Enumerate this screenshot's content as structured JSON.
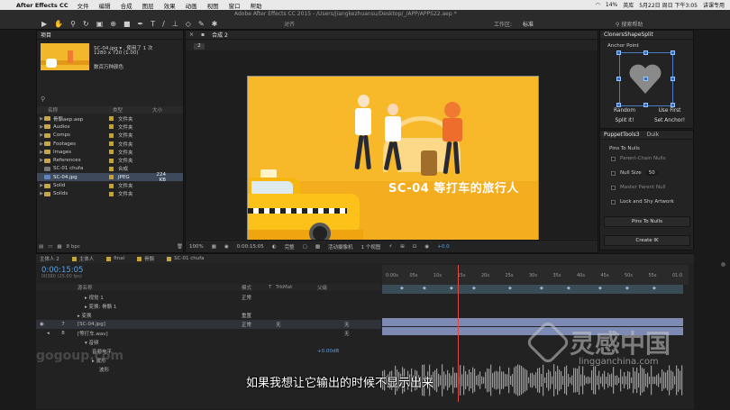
{
  "menubar": {
    "app": "After Effects CC",
    "items": [
      "文件",
      "编辑",
      "合成",
      "图层",
      "效果",
      "动画",
      "视图",
      "窗口",
      "帮助"
    ],
    "status": [
      "14%",
      "英库",
      "5月22日 周日 下午3:05",
      "讲课专用"
    ]
  },
  "window_title": "Adobe After Effects CC 2015 - /Users/jiangkezhuansu/Desktop/_/APP/APPS22.aep *",
  "toolbar": {
    "align": "对齐",
    "workspace_label": "工作区:",
    "workspace_value": "标准",
    "search": "搜索帮助"
  },
  "project": {
    "tab": "项目",
    "selected_name": "SC-04.jpg ▾ , 使用了 1 次",
    "selected_dims": "1280 x 720 (1.00)",
    "selected_colors": "数百万种颜色",
    "columns": [
      "名称",
      "类型",
      "大小"
    ],
    "items": [
      {
        "name": "骨骼aep.aep",
        "type": "文件夹",
        "size": "",
        "kind": "folder"
      },
      {
        "name": "Audios",
        "type": "文件夹",
        "size": "",
        "kind": "folder"
      },
      {
        "name": "Comps",
        "type": "文件夹",
        "size": "",
        "kind": "folder"
      },
      {
        "name": "Footages",
        "type": "文件夹",
        "size": "",
        "kind": "folder"
      },
      {
        "name": "Images",
        "type": "文件夹",
        "size": "",
        "kind": "folder"
      },
      {
        "name": "References",
        "type": "文件夹",
        "size": "",
        "kind": "folder"
      },
      {
        "name": "SC-01 chufa",
        "type": "合成",
        "size": "",
        "kind": "comp"
      },
      {
        "name": "SC-04.jpg",
        "type": "JPEG",
        "size": "224 KB",
        "kind": "img"
      },
      {
        "name": "Solid",
        "type": "文件夹",
        "size": "",
        "kind": "folder"
      },
      {
        "name": "Solids",
        "type": "文件夹",
        "size": "",
        "kind": "folder"
      }
    ],
    "bpc": "8 bpc"
  },
  "composition": {
    "tab_label": "合成 2",
    "comp_number": "2",
    "caption": "SC-04 等打车的旅行人",
    "footer": {
      "zoom": "100%",
      "timecode": "0:00:15:05",
      "quality": "完整",
      "camera": "活动摄像机",
      "views": "1 个视图",
      "exposure": "+0.0"
    }
  },
  "clone": {
    "title": "ClonersShapeSplit",
    "anchor": "Anchor Point",
    "buttons": [
      "Random",
      "Use First",
      "Split it!",
      "Set Anchor!"
    ]
  },
  "puppet": {
    "tabs": [
      "PuppetTools3",
      "Duik"
    ],
    "pins_to_nulls_header": "Pins To Nulls",
    "parent_chain": "Parent-Chain Nulls",
    "null_size_label": "Null Size",
    "null_size_value": "50",
    "master_parent": "Master Parent Null",
    "lock_shy": "Lock and Shy Artwork",
    "pins_button": "Pins To Nulls",
    "create_ik": "Create IK"
  },
  "timeline": {
    "tabs": [
      "主体人 2",
      "主体人",
      "final",
      "骨骼",
      "SC-01 chufa"
    ],
    "timecode": "0:00:15:05",
    "frames": "00380 (25.00 fps)",
    "columns": [
      "源名称",
      "模式",
      "T",
      "TrkMat",
      "父级"
    ],
    "rows": [
      {
        "name": "▸ 视觉 1",
        "mode": "正常",
        "num": "",
        "indent": 1
      },
      {
        "name": "▸ 变换: 骨骼 1",
        "mode": "",
        "num": "",
        "indent": 1
      },
      {
        "name": "▸ 变换",
        "mode": "重置",
        "num": "",
        "indent": 0
      },
      {
        "name": "[SC-04.jpg]",
        "mode": "正常",
        "num": "7",
        "indent": 0,
        "parent": "无",
        "trk": "无"
      },
      {
        "name": "[等打车.wav]",
        "mode": "",
        "num": "8",
        "indent": 0,
        "parent": "无"
      },
      {
        "name": "▾ 音频",
        "mode": "",
        "num": "",
        "indent": 1
      },
      {
        "name": "音频电平",
        "mode": "",
        "num": "",
        "indent": 2,
        "value": "+0.00dB"
      },
      {
        "name": "▸ 波形",
        "mode": "",
        "num": "",
        "indent": 2
      },
      {
        "name": "波形",
        "mode": "",
        "num": "",
        "indent": 3
      }
    ],
    "ruler": [
      "0:00s",
      "05s",
      "10s",
      "15s",
      "20s",
      "25s",
      "30s",
      "35s",
      "40s",
      "45s",
      "50s",
      "55s",
      "01:0"
    ]
  },
  "subtitle": "如果我想让它输出的时候不显示出来",
  "watermark": {
    "left": "gogoup.com",
    "right_big": "灵感中国",
    "right_small": "lingganchina.com"
  }
}
